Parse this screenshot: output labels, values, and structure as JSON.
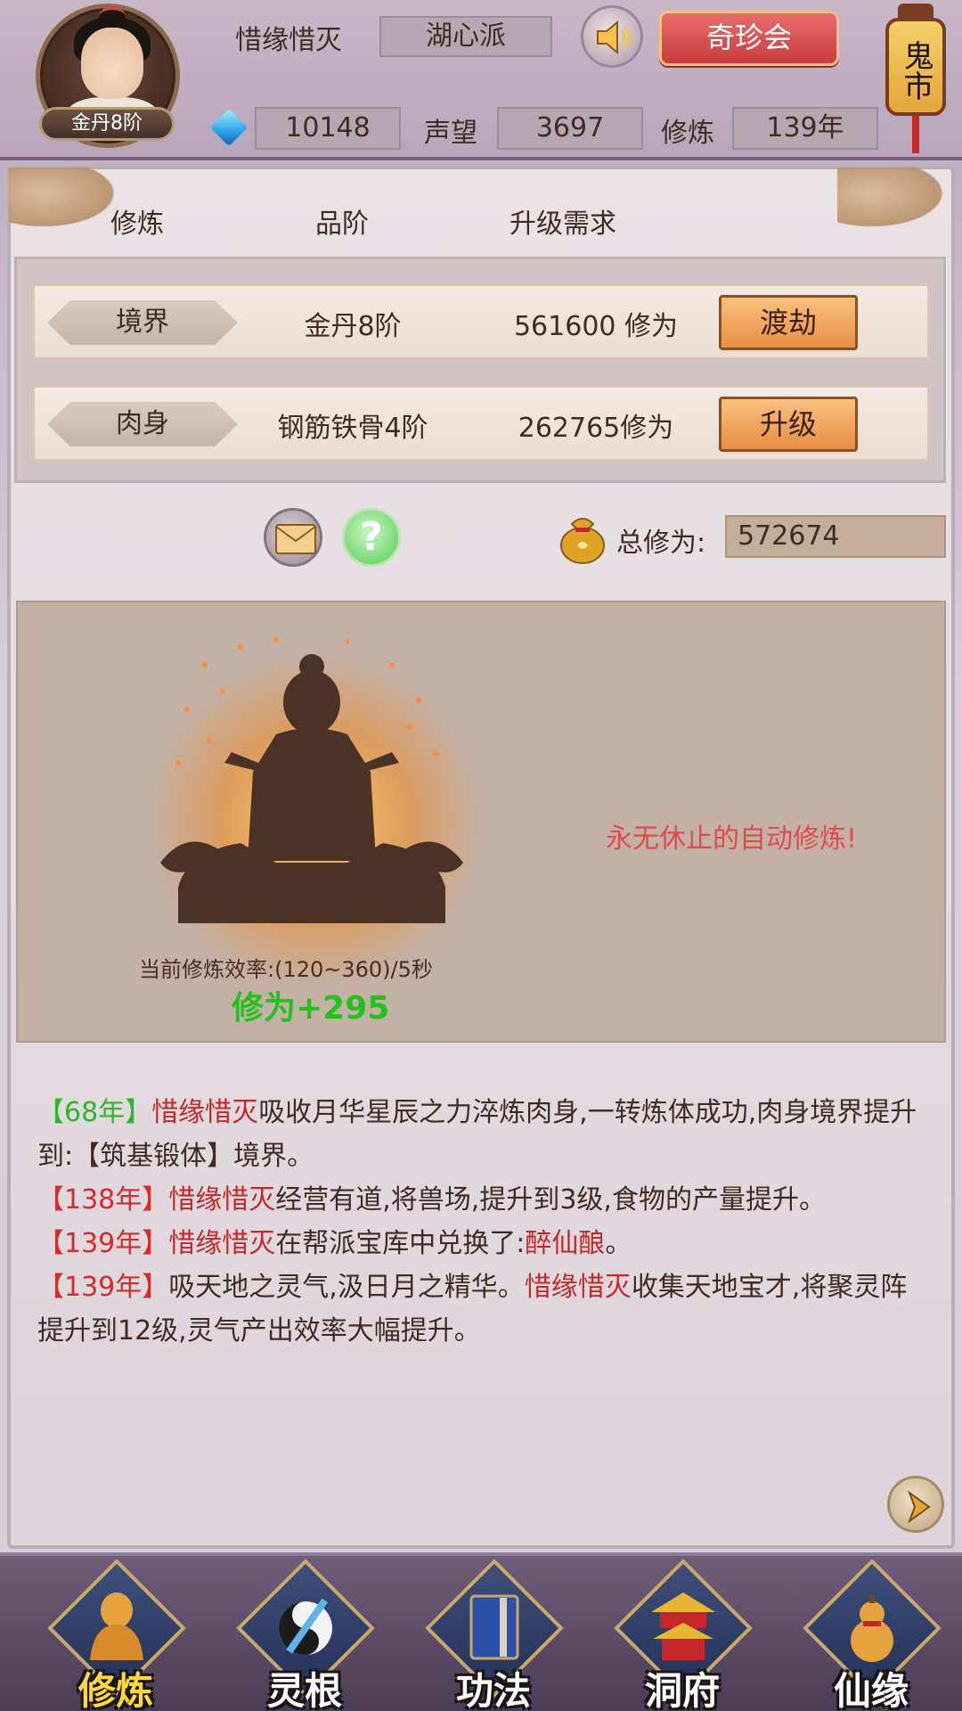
{
  "header": {
    "rank_badge": "金丹8阶",
    "player_name": "惜缘惜灭",
    "sect": "湖心派",
    "market_button": "奇珍会",
    "ghost_market": "鬼市",
    "gems": "10148",
    "reputation_label": "声望",
    "reputation": "3697",
    "cultivation_label": "修炼",
    "cultivation_years": "139年"
  },
  "columns": {
    "col1": "修炼",
    "col2": "品阶",
    "col3": "升级需求"
  },
  "rows": [
    {
      "tag": "境界",
      "grade": "金丹8阶",
      "requirement": "561600 修为",
      "button": "渡劫"
    },
    {
      "tag": "肉身",
      "grade": "钢筋铁骨4阶",
      "requirement": "262765修为",
      "button": "升级"
    }
  ],
  "total": {
    "label": "总修为:",
    "value": "572674"
  },
  "meditation": {
    "auto_text": "永无休止的自动修炼!",
    "efficiency": "当前修炼效率:(120~360)/5秒",
    "gain": "修为+295"
  },
  "log": [
    {
      "year": "【68年】",
      "name": "惜缘惜灭",
      "text": "吸收月华星辰之力淬炼肉身,一转炼体成功,肉身境界提升到:【筑基锻体】境界。"
    },
    {
      "year": "【138年】",
      "name": "惜缘惜灭",
      "text": "经营有道,将兽场,提升到3级,食物的产量提升。"
    },
    {
      "year": "【139年】",
      "name": "惜缘惜灭",
      "text": "在帮派宝库中兑换了:",
      "item": "醉仙酿",
      "tail": "。"
    },
    {
      "year": "【139年】",
      "pre": "吸天地之灵气,汲日月之精华。",
      "name": "惜缘惜灭",
      "text": "收集天地宝才,将聚灵阵提升到12级,灵气产出效率大幅提升。"
    }
  ],
  "nav": [
    {
      "label": "修炼",
      "icon": "monk-icon",
      "active": true
    },
    {
      "label": "灵根",
      "icon": "yin-yang-sword-icon",
      "active": false
    },
    {
      "label": "功法",
      "icon": "book-icon",
      "active": false
    },
    {
      "label": "洞府",
      "icon": "pagoda-icon",
      "active": false
    },
    {
      "label": "仙缘",
      "icon": "gourd-icon",
      "active": false
    }
  ],
  "colors": {
    "accent_red": "#e24a4a",
    "gain_green": "#22c21a",
    "button_orange": "#e88f43"
  }
}
